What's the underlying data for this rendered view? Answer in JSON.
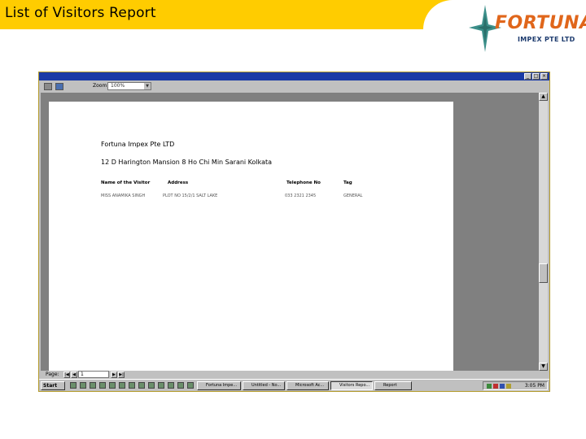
{
  "slide": {
    "title": "List of Visitors Report",
    "logo_text": "FORTUNA",
    "logo_subtext": "IMPEX PTE LTD",
    "accent_color": "#ffcc00",
    "logo_color": "#e0661b"
  },
  "app": {
    "zoom_label": "Zoom",
    "zoom_value": "100%",
    "window_buttons": [
      "_",
      "□",
      "×"
    ]
  },
  "report": {
    "company": "Fortuna Impex Pte LTD",
    "address": "12 D Harington Mansion 8 Ho Chi Min Sarani Kolkata",
    "columns": [
      "Name of the Visitor",
      "Address",
      "Telephone No",
      "Tag"
    ],
    "rows": [
      {
        "name": "MISS ANAMIKA SINGH",
        "address": "PLOT NO 15/2/1 SALT LAKE",
        "phone": "033 2321 2345",
        "tag": "GENERAL"
      }
    ]
  },
  "navigation": {
    "page_label": "Page:",
    "page_value": "1"
  },
  "taskbar": {
    "start_label": "Start",
    "tasks": [
      "Fortuna Impe...",
      "Untitled - No...",
      "Microsoft Ac...",
      "Visitors Repo...",
      "Report"
    ],
    "clock": "3:05 PM"
  }
}
